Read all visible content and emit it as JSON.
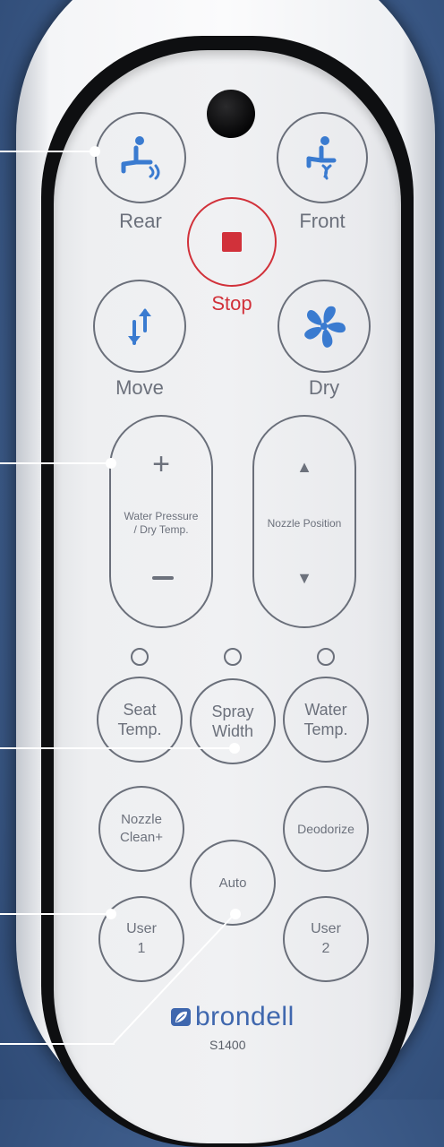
{
  "remote": {
    "buttons": {
      "rear": "Rear",
      "front": "Front",
      "stop": "Stop",
      "move": "Move",
      "dry": "Dry",
      "seat_temp": [
        "Seat",
        "Temp."
      ],
      "spray_width": [
        "Spray",
        "Width"
      ],
      "water_temp": [
        "Water",
        "Temp."
      ],
      "nozzle_clean": [
        "Nozzle",
        "Clean+"
      ],
      "deodorize": "Deodorize",
      "auto": "Auto",
      "user1": [
        "User",
        "1"
      ],
      "user2": [
        "User",
        "2"
      ]
    },
    "pills": {
      "water_pressure": [
        "Water Pressure",
        "/ Dry Temp."
      ],
      "nozzle_position": "Nozzle Position"
    },
    "brand": "brondell",
    "model": "S1400"
  },
  "colors": {
    "icon_blue": "#3a7bd0",
    "stop_red": "#d1313a",
    "button_outline": "#6a6f7a",
    "brand_blue": "#3f67ae"
  }
}
